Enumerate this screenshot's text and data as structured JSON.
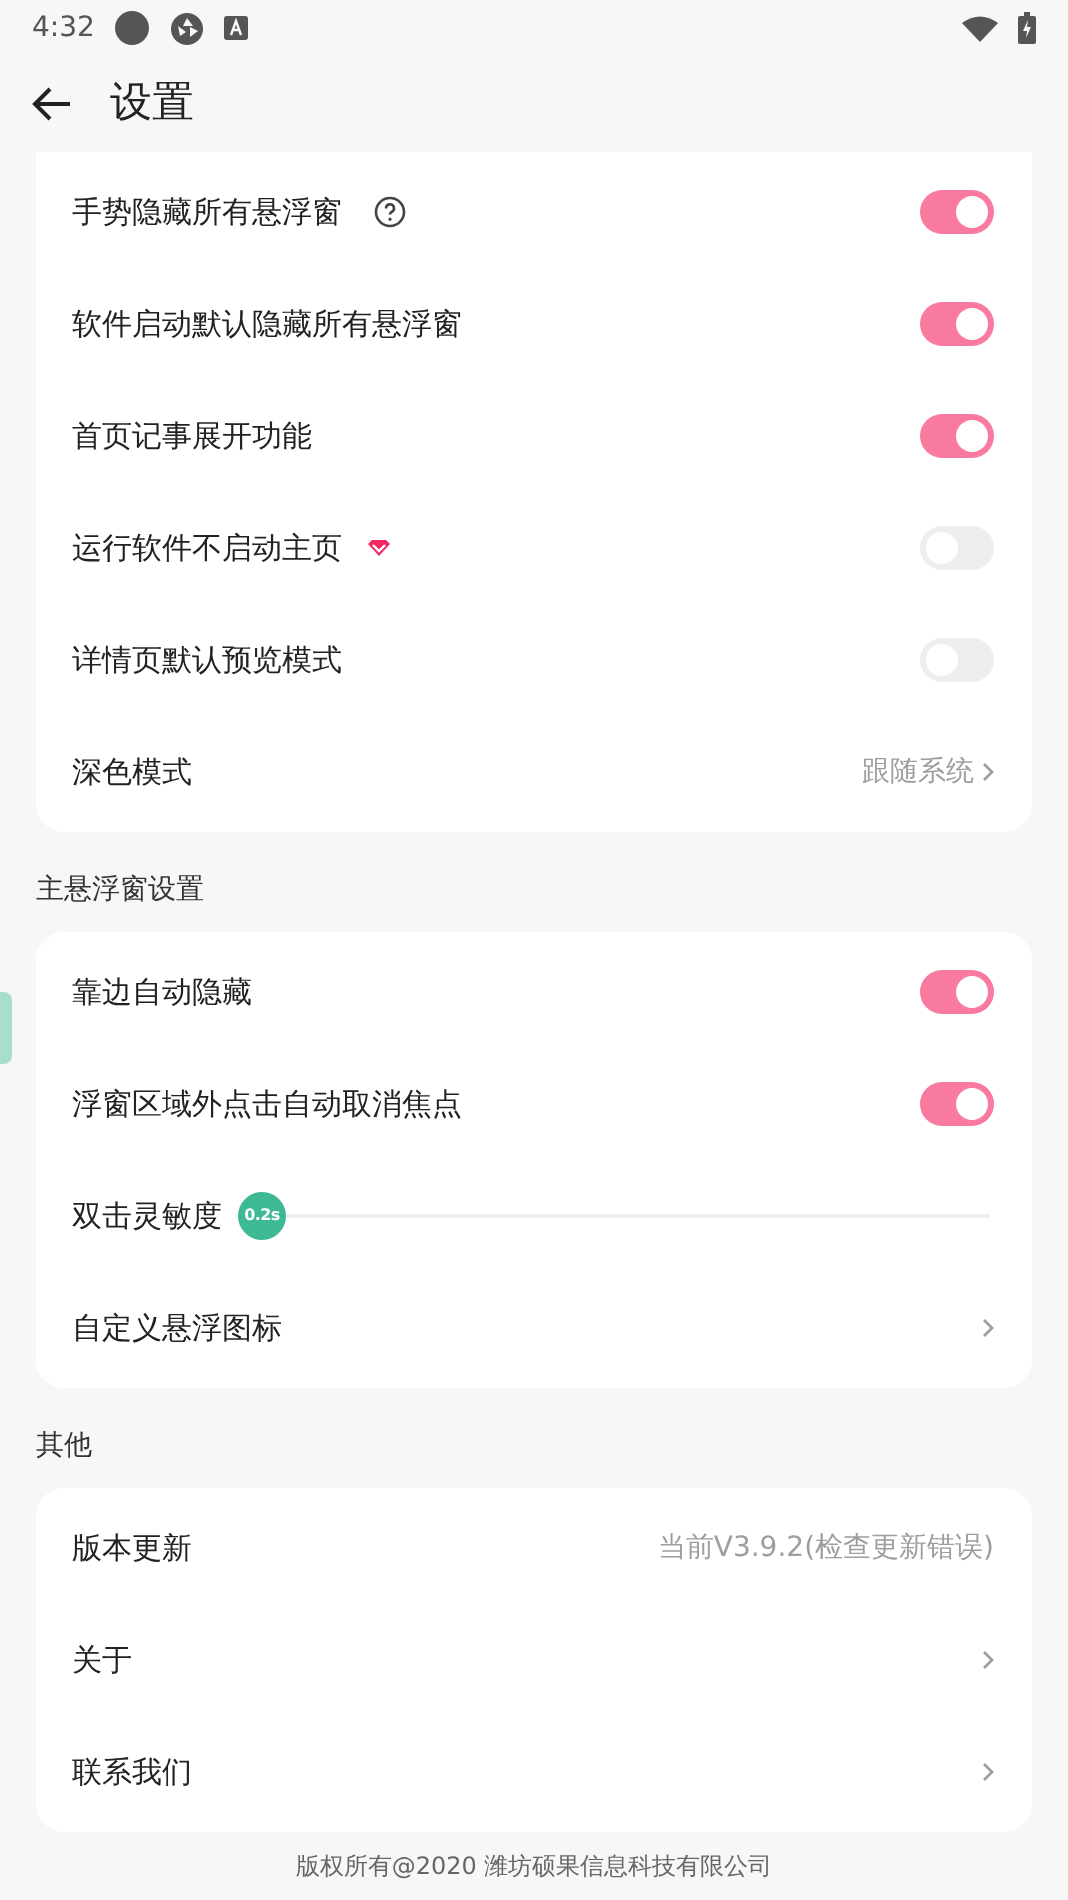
{
  "status_bar": {
    "time": "4:32"
  },
  "header": {
    "title": "设置"
  },
  "sections": [
    {
      "rows": [
        {
          "kind": "toggle",
          "label": "手势隐藏所有悬浮窗",
          "on": true
        },
        {
          "kind": "toggle",
          "label": "软件启动默认隐藏所有悬浮窗",
          "on": true
        },
        {
          "kind": "toggle",
          "label": "首页记事展开功能",
          "on": true
        },
        {
          "kind": "toggle",
          "label": "运行软件不启动主页",
          "on": false
        },
        {
          "kind": "toggle",
          "label": "详情页默认预览模式",
          "on": false
        },
        {
          "kind": "link",
          "label": "深色模式",
          "value": "跟随系统"
        }
      ]
    },
    {
      "title": "主悬浮窗设置",
      "rows": [
        {
          "kind": "toggle",
          "label": "靠边自动隐藏",
          "on": true
        },
        {
          "kind": "toggle",
          "label": "浮窗区域外点击自动取消焦点",
          "on": true
        },
        {
          "kind": "slider",
          "label": "双击灵敏度",
          "thumb": "0.2s",
          "level": 0
        },
        {
          "kind": "link",
          "label": "自定义悬浮图标"
        }
      ]
    },
    {
      "title": "其他",
      "rows": [
        {
          "kind": "info",
          "label": "版本更新",
          "value": "当前V3.9.2(检查更新错误)"
        },
        {
          "kind": "link",
          "label": "关于"
        },
        {
          "kind": "link",
          "label": "联系我们"
        }
      ]
    }
  ],
  "footer": "版权所有@2020 潍坊硕果信息科技有限公司"
}
